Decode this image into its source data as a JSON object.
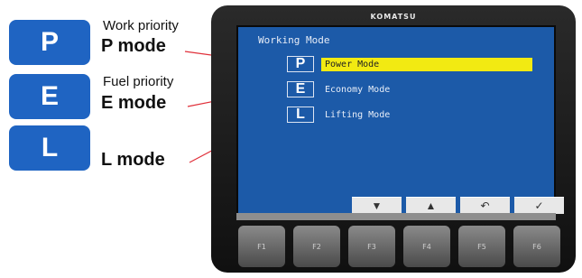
{
  "legend": [
    {
      "letter": "P",
      "caption": "Work priority",
      "title": "P mode"
    },
    {
      "letter": "E",
      "caption": "Fuel priority",
      "title": "E mode"
    },
    {
      "letter": "L",
      "caption": "",
      "title": "L mode"
    }
  ],
  "device": {
    "brand": "KOMATSU",
    "screen_title": "Working Mode",
    "modes": [
      {
        "key": "P",
        "label": "Power Mode",
        "selected": true
      },
      {
        "key": "E",
        "label": "Economy Mode",
        "selected": false
      },
      {
        "key": "L",
        "label": "Lifting Mode",
        "selected": false
      }
    ],
    "softkeys": [
      "▼",
      "▲",
      "↶",
      "✓"
    ],
    "function_keys": [
      "F1",
      "F2",
      "F3",
      "F4",
      "F5",
      "F6"
    ]
  },
  "colors": {
    "badge_blue": "#1f64c2",
    "screen_blue": "#1c5aa8",
    "highlight_yellow": "#f2ea12",
    "line_red": "#e0303a"
  }
}
